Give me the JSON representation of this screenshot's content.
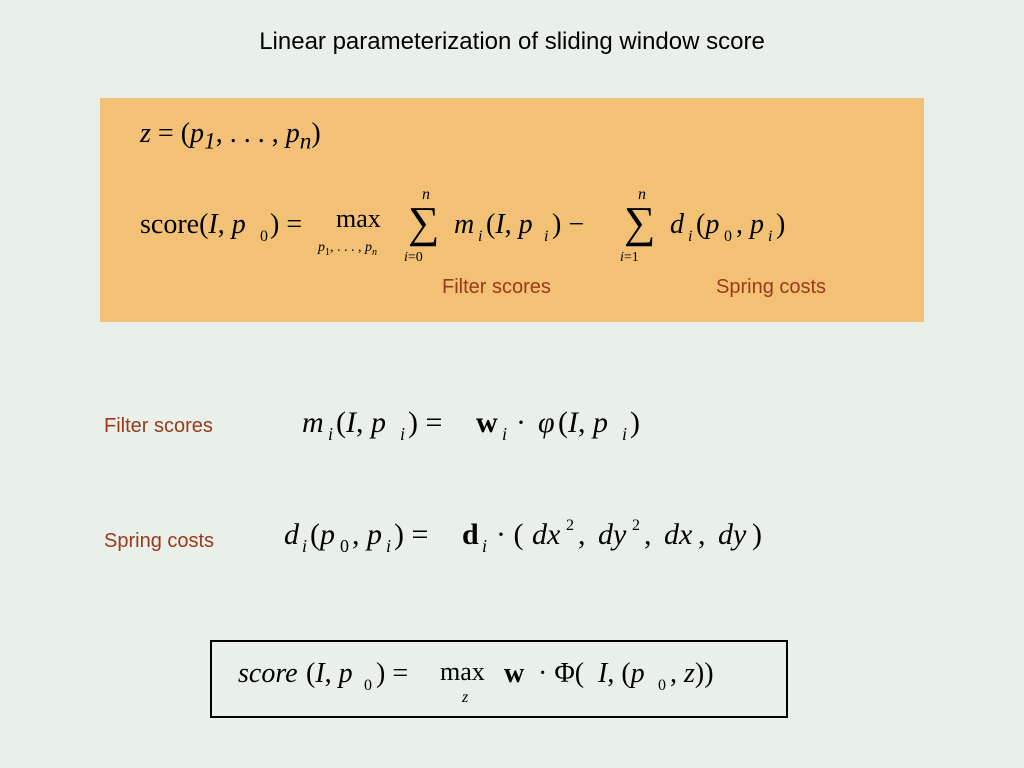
{
  "title": "Linear parameterization of sliding window score",
  "annotations": {
    "filter_scores": "Filter scores",
    "spring_costs": "Spring costs"
  },
  "labels": {
    "filter_scores": "Filter scores",
    "spring_costs": "Spring costs"
  },
  "chart_data": {
    "type": "table",
    "title": "Equations",
    "rows": [
      {
        "name": "latent_config",
        "latex": "z = (p_1, \\ldots, p_n)"
      },
      {
        "name": "score_main",
        "latex": "score(I, p_0) = \\max_{p_1,\\ldots,p_n} \\sum_{i=0}^{n} m_i(I, p_i) - \\sum_{i=1}^{n} d_i(p_0, p_i)"
      },
      {
        "name": "filter_score",
        "latex": "m_i(I, p_i) = \\mathbf{w}_i \\cdot \\phi(I, p_i)"
      },
      {
        "name": "spring_cost",
        "latex": "d_i(p_0, p_i) = \\mathbf{d}_i \\cdot (dx^2, dy^2, dx, dy)"
      },
      {
        "name": "score_compact",
        "latex": "score(I, p_0) = \\max_{z} \\mathbf{w} \\cdot \\Phi(I, (p_0, z))"
      }
    ]
  }
}
